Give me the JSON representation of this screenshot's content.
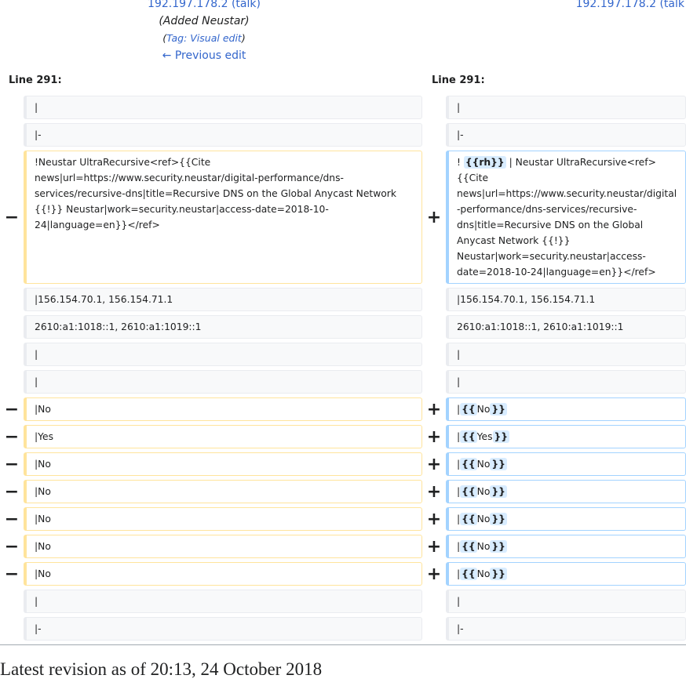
{
  "header_left": {
    "user": "192.197.178.2",
    "talk": "(talk)",
    "summary": "(Added Neustar)",
    "tag_open": "(",
    "tag": "Tag: Visual edit",
    "tag_close": ")",
    "prev": "← Previous edit"
  },
  "header_right": {
    "user": "192.197.178.2",
    "talk": "(talk"
  },
  "line_left": "Line 291:",
  "line_right": "Line 291:",
  "markers": {
    "del": "−",
    "add": "+"
  },
  "rows": [
    {
      "type": "ctx",
      "left": "|",
      "right": [
        {
          "t": "|"
        }
      ]
    },
    {
      "type": "ctx",
      "left": "|-",
      "right": [
        {
          "t": "|-"
        }
      ]
    },
    {
      "type": "chg",
      "left": "!Neustar UltraRecursive<ref>{{Cite news|url=https://www.security.neustar/digital-performance/dns-services/recursive-dns|title=Recursive DNS on the Global Anycast Network {{!}} Neustar|work=security.neustar|access-date=2018-10-24|language=en}}</ref>",
      "right": [
        {
          "t": "! "
        },
        {
          "t": "{{rh}}",
          "ins": true
        },
        {
          "t": " | Neustar UltraRecursive<ref>{{Cite news|url=https://www.security.neustar/digital-performance/dns-services/recursive-dns|title=Recursive DNS on the Global Anycast Network {{!}} Neustar|work=security.neustar|access-date=2018-10-24|language=en}}</ref>"
        }
      ]
    },
    {
      "type": "ctx",
      "left": "|156.154.70.1, 156.154.71.1",
      "right": [
        {
          "t": "|156.154.70.1, 156.154.71.1"
        }
      ]
    },
    {
      "type": "ctx",
      "left": "2610:a1:1018::1, 2610:a1:1019::1",
      "right": [
        {
          "t": "2610:a1:1018::1, 2610:a1:1019::1"
        }
      ]
    },
    {
      "type": "ctx",
      "left": "|",
      "right": [
        {
          "t": "|"
        }
      ]
    },
    {
      "type": "ctx",
      "left": "|",
      "right": [
        {
          "t": "|"
        }
      ]
    },
    {
      "type": "chg",
      "left": "|No",
      "right": [
        {
          "t": "|"
        },
        {
          "t": "{{",
          "ins": true
        },
        {
          "t": "No"
        },
        {
          "t": "}}",
          "ins": true
        }
      ]
    },
    {
      "type": "chg",
      "left": "|Yes",
      "right": [
        {
          "t": "|"
        },
        {
          "t": "{{",
          "ins": true
        },
        {
          "t": "Yes"
        },
        {
          "t": "}}",
          "ins": true
        }
      ]
    },
    {
      "type": "chg",
      "left": "|No",
      "right": [
        {
          "t": "|"
        },
        {
          "t": "{{",
          "ins": true
        },
        {
          "t": "No"
        },
        {
          "t": "}}",
          "ins": true
        }
      ]
    },
    {
      "type": "chg",
      "left": "|No",
      "right": [
        {
          "t": "|"
        },
        {
          "t": "{{",
          "ins": true
        },
        {
          "t": "No"
        },
        {
          "t": "}}",
          "ins": true
        }
      ]
    },
    {
      "type": "chg",
      "left": "|No",
      "right": [
        {
          "t": "|"
        },
        {
          "t": "{{",
          "ins": true
        },
        {
          "t": "No"
        },
        {
          "t": "}}",
          "ins": true
        }
      ]
    },
    {
      "type": "chg",
      "left": "|No",
      "right": [
        {
          "t": "|"
        },
        {
          "t": "{{",
          "ins": true
        },
        {
          "t": "No"
        },
        {
          "t": "}}",
          "ins": true
        }
      ]
    },
    {
      "type": "chg",
      "left": "|No",
      "right": [
        {
          "t": "|"
        },
        {
          "t": "{{",
          "ins": true
        },
        {
          "t": "No"
        },
        {
          "t": "}}",
          "ins": true
        }
      ]
    },
    {
      "type": "ctx",
      "left": "|",
      "right": [
        {
          "t": "|"
        }
      ]
    },
    {
      "type": "ctx",
      "left": "|-",
      "right": [
        {
          "t": "|-"
        }
      ]
    }
  ],
  "footer": "Latest revision as of 20:13, 24 October 2018"
}
